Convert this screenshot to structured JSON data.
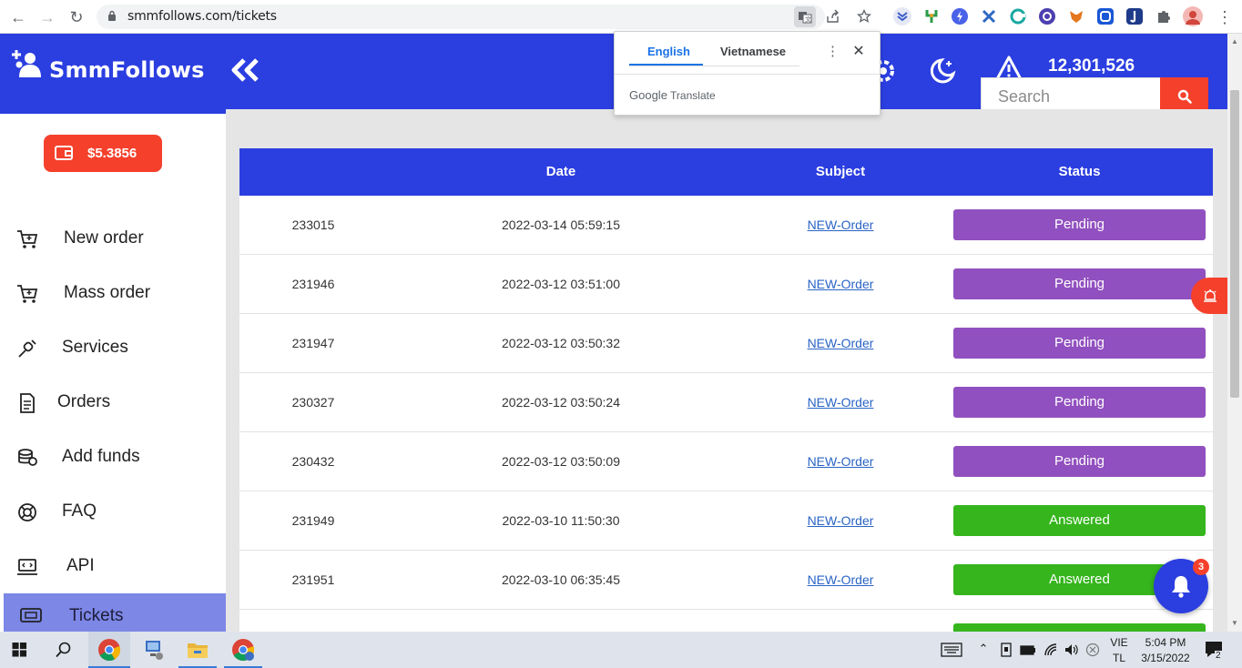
{
  "browser": {
    "url": "smmfollows.com/tickets",
    "nav": {
      "back": "←",
      "forward": "→",
      "reload": "↻"
    },
    "omnibox_icons": [
      "translate-icon",
      "share-icon",
      "bookmark-star-icon"
    ],
    "extension_colors": [
      "#3b5cc9",
      "#2c9b4a",
      "#4a62e8",
      "#2d68c4",
      "#1aa8a2",
      "#4c3fb0",
      "#e4761b",
      "#1a57d6",
      "#1e3a8a",
      "#5f6368"
    ]
  },
  "translate_popup": {
    "tab_english": "English",
    "tab_vietnamese": "Vietnamese",
    "footer_google": "Google",
    "footer_translate": "Translate",
    "menu_icon": "⋮",
    "close_icon": "✕"
  },
  "sidebar": {
    "brand": "SmmFollows",
    "balance": "$5.3856",
    "items": [
      {
        "label": "New order",
        "icon": "cart-icon"
      },
      {
        "label": "Mass order",
        "icon": "cart-icon"
      },
      {
        "label": "Services",
        "icon": "link-icon"
      },
      {
        "label": "Orders",
        "icon": "document-icon"
      },
      {
        "label": "Add funds",
        "icon": "coins-icon"
      },
      {
        "label": "FAQ",
        "icon": "lifebuoy-icon"
      },
      {
        "label": "API",
        "icon": "laptop-code-icon"
      },
      {
        "label": "Tickets",
        "icon": "ticket-icon"
      }
    ]
  },
  "header": {
    "counter": "12,301,526",
    "search_placeholder": "Search"
  },
  "table": {
    "columns": [
      "",
      "Date",
      "Subject",
      "Status"
    ],
    "rows": [
      {
        "id": "233015",
        "date": "2022-03-14 05:59:15",
        "subject": "NEW-Order",
        "status": "Pending"
      },
      {
        "id": "231946",
        "date": "2022-03-12 03:51:00",
        "subject": "NEW-Order",
        "status": "Pending"
      },
      {
        "id": "231947",
        "date": "2022-03-12 03:50:32",
        "subject": "NEW-Order",
        "status": "Pending"
      },
      {
        "id": "230327",
        "date": "2022-03-12 03:50:24",
        "subject": "NEW-Order",
        "status": "Pending"
      },
      {
        "id": "230432",
        "date": "2022-03-12 03:50:09",
        "subject": "NEW-Order",
        "status": "Pending"
      },
      {
        "id": "231949",
        "date": "2022-03-10 11:50:30",
        "subject": "NEW-Order",
        "status": "Answered"
      },
      {
        "id": "231951",
        "date": "2022-03-10 06:35:45",
        "subject": "NEW-Order",
        "status": "Answered"
      }
    ]
  },
  "notifications": {
    "badge": "3"
  },
  "colors": {
    "brand_blue": "#2b3ee0",
    "accent_red": "#f5402c",
    "pending": "#9150bf",
    "answered": "#36b51d",
    "active_nav": "#7c87e6"
  },
  "taskbar": {
    "lang_top": "VIE",
    "lang_bottom": "TL",
    "time": "5:04 PM",
    "date": "3/15/2022",
    "notif_count": "2"
  }
}
